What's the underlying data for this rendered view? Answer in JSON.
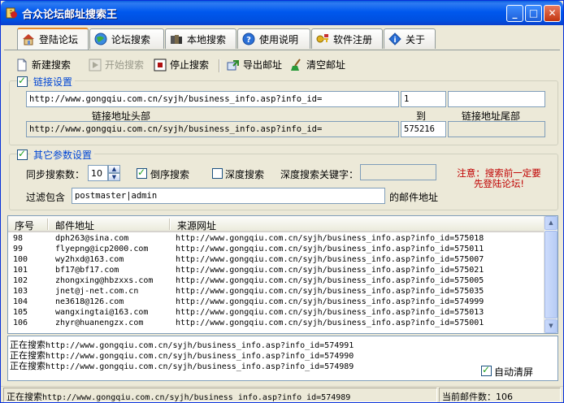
{
  "window": {
    "title": "合众论坛邮址搜索王",
    "minimize_label": "_",
    "maximize_label": "□",
    "close_label": "✕"
  },
  "tabs": [
    {
      "label": "登陆论坛",
      "icon": "house-icon",
      "active": true
    },
    {
      "label": "论坛搜索",
      "icon": "globe-icon",
      "active": false
    },
    {
      "label": "本地搜索",
      "icon": "books-icon",
      "active": false
    },
    {
      "label": "使用说明",
      "icon": "help-icon",
      "active": false
    },
    {
      "label": "软件注册",
      "icon": "key-icon",
      "active": false
    },
    {
      "label": "关于",
      "icon": "info-icon",
      "active": false
    }
  ],
  "toolbar": {
    "new_search": "新建搜索",
    "start_search": "开始搜索",
    "stop_search": "停止搜索",
    "export": "导出邮址",
    "clear": "清空邮址"
  },
  "link_settings": {
    "title": "链接设置",
    "checked": true,
    "header_url": "http://www.gongqiu.com.cn/syjh/business_info.asp?info_id=",
    "start_num": "1",
    "tail_top": "",
    "header_label": "链接地址头部",
    "to_label": "到",
    "tail_label": "链接地址尾部",
    "header_url_ro": "http://www.gongqiu.com.cn/syjh/business_info.asp?info_id=",
    "end_num": "575216",
    "tail_ro": ""
  },
  "other_settings": {
    "title": "其它参数设置",
    "checked": true,
    "sync_label": "同步搜索数：",
    "sync_value": "10",
    "reverse_label": "倒序搜索",
    "reverse_checked": true,
    "depth_label": "深度搜索",
    "depth_checked": false,
    "depth_keyword_label": "深度搜索关键字：",
    "depth_keyword_value": "",
    "filter_label": "过滤包含",
    "filter_value": "postmaster|admin",
    "filter_suffix": "的邮件地址",
    "warning_line1": "注意：搜索前一定要",
    "warning_line2": "先登陆论坛!"
  },
  "results": {
    "columns": [
      "序号",
      "邮件地址",
      "来源网址"
    ],
    "rows": [
      {
        "id": "98",
        "email": "dph263@sina.com",
        "url": "http://www.gongqiu.com.cn/syjh/business_info.asp?info_id=575018"
      },
      {
        "id": "99",
        "email": "flyepng@icp2000.com",
        "url": "http://www.gongqiu.com.cn/syjh/business_info.asp?info_id=575011"
      },
      {
        "id": "100",
        "email": "wy2hxd@163.com",
        "url": "http://www.gongqiu.com.cn/syjh/business_info.asp?info_id=575007"
      },
      {
        "id": "101",
        "email": "bf17@bf17.com",
        "url": "http://www.gongqiu.com.cn/syjh/business_info.asp?info_id=575021"
      },
      {
        "id": "102",
        "email": "zhongxing@hbzxxs.com",
        "url": "http://www.gongqiu.com.cn/syjh/business_info.asp?info_id=575005"
      },
      {
        "id": "103",
        "email": "jnet@j-net.com.cn",
        "url": "http://www.gongqiu.com.cn/syjh/business_info.asp?info_id=575035"
      },
      {
        "id": "104",
        "email": "ne3618@126.com",
        "url": "http://www.gongqiu.com.cn/syjh/business_info.asp?info_id=574999"
      },
      {
        "id": "105",
        "email": "wangxingtai@163.com",
        "url": "http://www.gongqiu.com.cn/syjh/business_info.asp?info_id=575013"
      },
      {
        "id": "106",
        "email": "zhyr@huanengzx.com",
        "url": "http://www.gongqiu.com.cn/syjh/business_info.asp?info_id=575001"
      }
    ]
  },
  "log": {
    "prefix": "正在搜索",
    "lines": [
      "http://www.gongqiu.com.cn/syjh/business_info.asp?info_id=574991",
      "http://www.gongqiu.com.cn/syjh/business_info.asp?info_id=574990",
      "http://www.gongqiu.com.cn/syjh/business_info.asp?info_id=574989"
    ],
    "auto_clear_label": "自动清屏",
    "auto_clear_checked": true
  },
  "statusbar": {
    "prefix": "正在搜索",
    "url": "http://www.gongqiu.com.cn/syjh/business_info.asp?info_id=574989",
    "count_label": "当前邮件数：106"
  }
}
